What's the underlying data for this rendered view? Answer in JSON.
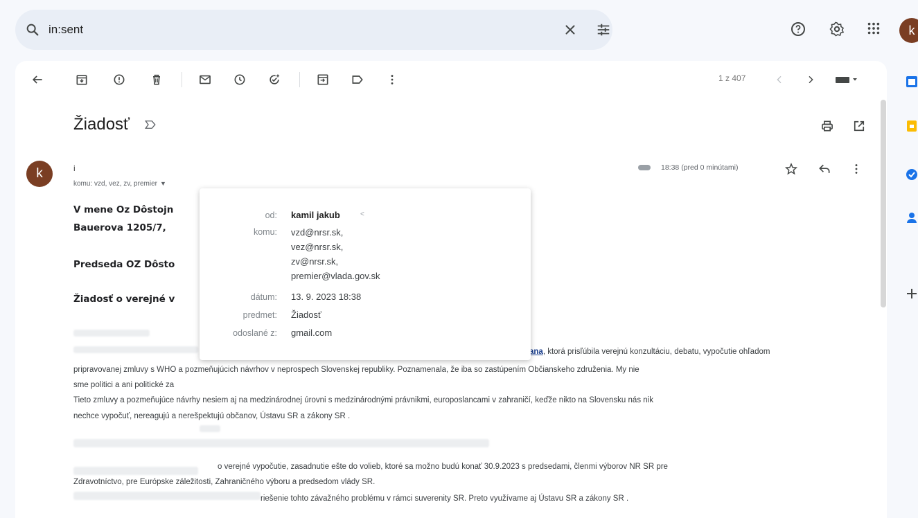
{
  "search": {
    "query": "in:sent"
  },
  "header": {
    "avatar_letter": "k"
  },
  "toolbar": {
    "pager": "1 z 407"
  },
  "email": {
    "subject": "Žiadosť",
    "avatar_letter": "k",
    "sender_short": "i",
    "recipients": "komu: vzd, vez, zv, premier",
    "time": "18:38 (pred 0 minútami)",
    "body": {
      "line1": "V mene Oz Dôstojn",
      "line2": "Bauerova 1205/7,",
      "line3": "Predseda OZ Dôsto",
      "line4": "Žiadosť o verejné v",
      "p1_link": "ana",
      "p1_a": ", ktorá prisľúbila verejnú konzultáciu, debatu, vypočutie ohľadom",
      "p1_b": "pripravovanej zmluvy s WHO a pozmeňujúcich návrhov v neprospech Slovenskej republiky. Poznamenala, že iba so zastúpením Občianskeho združenia. My nie",
      "p1_c": "sme politici a ani politické za",
      "p2_a": "Tieto zmluvy a pozmeňujúce návrhy nesiem aj na medzinárodnej úrovni s medzinárodnými právnikmi, europoslancami v zahraničí, keďže nikto na Slovensku nás nik",
      "p2_b": "nechce vypočuť, nereagujú a nerešpektujú občanov, Ústavu SR a zákony SR .",
      "p3_a": "o verejné vypočutie, zasadnutie ešte do volieb, ktoré sa možno budú konať 30.9.2023 s predsedami, členmi výborov NR SR pre",
      "p3_b": "Zdravotníctvo, pre Európske záležitosti, Zahraničného výboru a predsedom vlády SR.",
      "p3_c": "riešenie tohto závažného problému v rámci suverenity SR. Preto využívame aj Ústavu SR a zákony SR ."
    }
  },
  "popup": {
    "from_label": "od:",
    "from_value": "kamil jakub",
    "from_suffix": "<",
    "to_label": "komu:",
    "to_values": [
      "vzd@nrsr.sk,",
      "vez@nrsr.sk,",
      "zv@nrsr.sk,",
      "premier@vlada.gov.sk"
    ],
    "date_label": "dátum:",
    "date_value": "13. 9. 2023 18:38",
    "subject_label": "predmet:",
    "subject_value": "Žiadosť",
    "sent_by_label": "odoslané z:",
    "sent_by_value": "gmail.com"
  }
}
